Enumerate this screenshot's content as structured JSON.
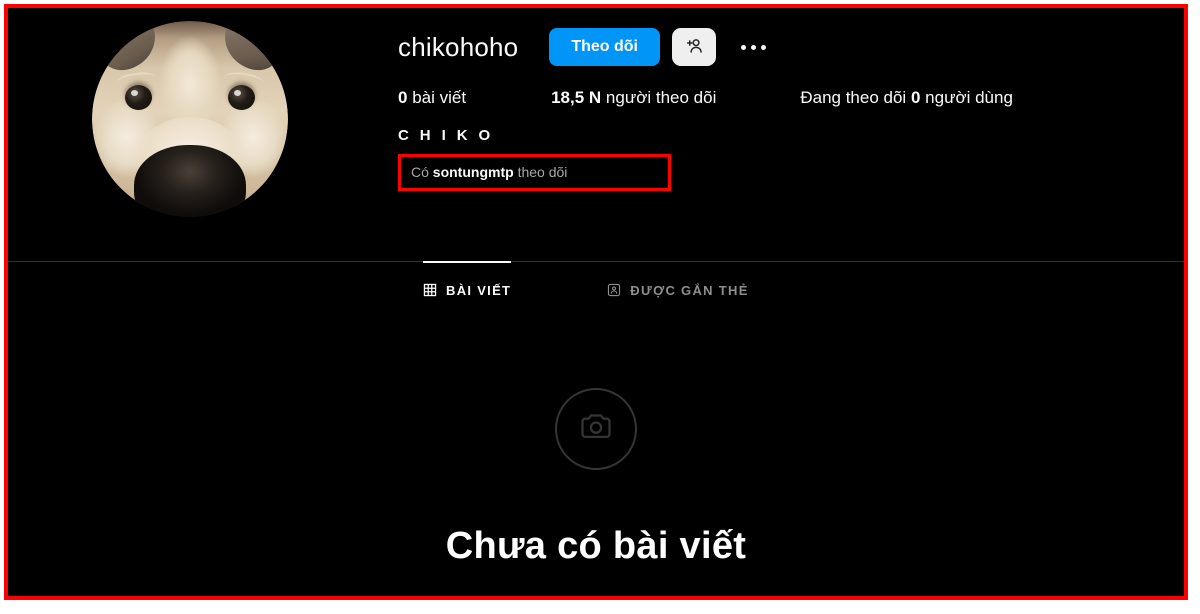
{
  "profile": {
    "avatar_alt": "chikohoho profile photo - shiba inu dog close up",
    "username": "chikohoho",
    "follow_button_label": "Theo dõi",
    "add_person_icon": "person-add-icon",
    "more_options_icon": "more-options-icon",
    "stats": {
      "posts": {
        "count": "0",
        "label": "bài viết"
      },
      "followers": {
        "count": "18,5 N",
        "label": "người theo dõi"
      },
      "following": {
        "prefix": "Đang theo dõi",
        "count": "0",
        "label": "người dùng"
      }
    },
    "full_name": "C H I K O",
    "followed_by": {
      "prefix": "Có",
      "name": "sontungmtp",
      "suffix": "theo dõi",
      "highlight_color": "#ff0000"
    }
  },
  "tabs": [
    {
      "id": "posts",
      "label": "BÀI VIẾT",
      "icon": "grid-icon",
      "active": true
    },
    {
      "id": "tagged",
      "label": "ĐƯỢC GẮN THẺ",
      "icon": "tagged-person-icon",
      "active": false
    }
  ],
  "empty_state": {
    "icon": "camera-icon",
    "title": "Chưa có bài viết"
  },
  "theme": {
    "background": "#000000",
    "text_primary": "#fafafa",
    "text_secondary": "#a8a8a8",
    "accent_blue": "#0095f6",
    "button_gray": "#efefef",
    "annotation_red": "#ff0000"
  }
}
